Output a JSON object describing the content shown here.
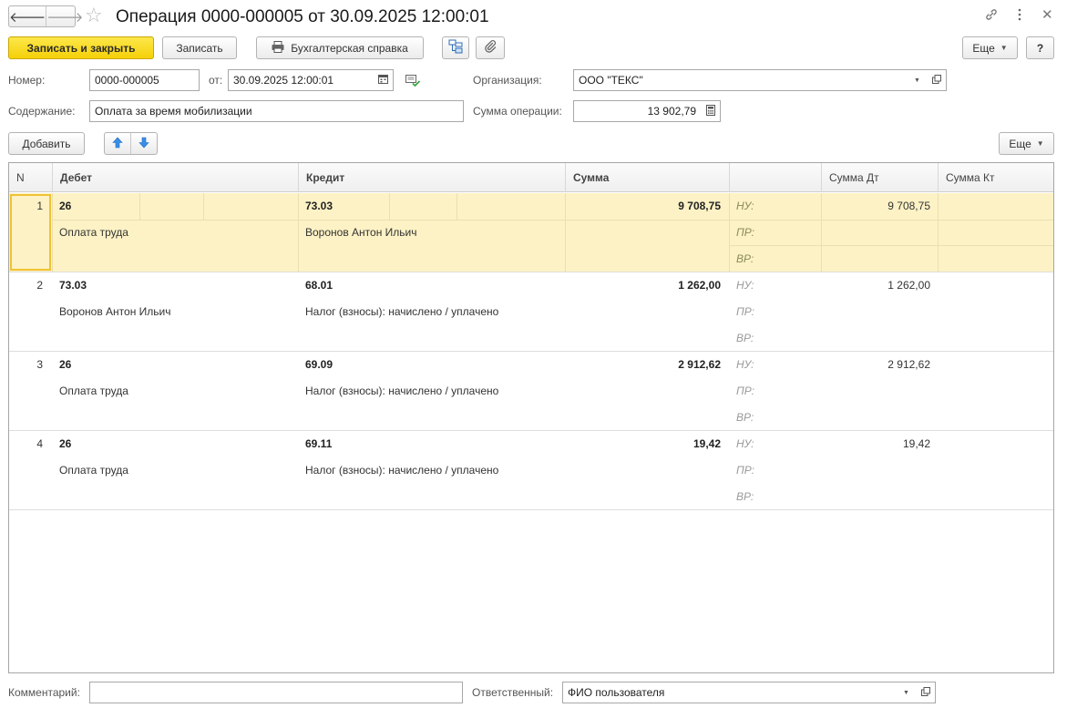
{
  "window": {
    "title": "Операция 0000-000005 от 30.09.2025 12:00:01"
  },
  "toolbar": {
    "save_close": "Записать и закрыть",
    "save": "Записать",
    "report": "Бухгалтерская справка",
    "more": "Еще",
    "help": "?"
  },
  "form": {
    "number_label": "Номер:",
    "number_value": "0000-000005",
    "date_label": "от:",
    "date_value": "30.09.2025 12:00:01",
    "org_label": "Организация:",
    "org_value": "ООО \"ТЕКС\"",
    "content_label": "Содержание:",
    "content_value": "Оплата за время мобилизации",
    "sum_label": "Сумма операции:",
    "sum_value": "13 902,79"
  },
  "table_toolbar": {
    "add": "Добавить",
    "more": "Еще"
  },
  "table": {
    "headers": {
      "n": "N",
      "debit": "Дебет",
      "credit": "Кредит",
      "sum": "Сумма",
      "sum_dt": "Сумма Дт",
      "sum_kt": "Сумма Кт"
    },
    "rows": [
      {
        "n": "1",
        "debit": "26",
        "debit_sub": "Оплата труда",
        "credit": "73.03",
        "credit_sub": "Воронов Антон Ильич",
        "sum": "9 708,75",
        "nu": "НУ:",
        "pr": "ПР:",
        "vr": "ВР:",
        "sum_dt": "9 708,75"
      },
      {
        "n": "2",
        "debit": "73.03",
        "debit_sub": "Воронов Антон Ильич",
        "credit": "68.01",
        "credit_sub": "Налог (взносы): начислено / уплачено",
        "sum": "1 262,00",
        "nu": "НУ:",
        "pr": "ПР:",
        "vr": "ВР:",
        "sum_dt": "1 262,00"
      },
      {
        "n": "3",
        "debit": "26",
        "debit_sub": "Оплата труда",
        "credit": "69.09",
        "credit_sub": "Налог (взносы): начислено / уплачено",
        "sum": "2 912,62",
        "nu": "НУ:",
        "pr": "ПР:",
        "vr": "ВР:",
        "sum_dt": "2 912,62"
      },
      {
        "n": "4",
        "debit": "26",
        "debit_sub": "Оплата труда",
        "credit": "69.11",
        "credit_sub": "Налог (взносы): начислено / уплачено",
        "sum": "19,42",
        "nu": "НУ:",
        "pr": "ПР:",
        "vr": "ВР:",
        "sum_dt": "19,42"
      }
    ]
  },
  "footer": {
    "comment_label": "Комментарий:",
    "comment_value": "",
    "responsible_label": "Ответственный:",
    "responsible_value": "ФИО пользователя"
  },
  "icons": {
    "back": "arrow-left-icon",
    "forward": "arrow-right-icon",
    "favorite": "star-icon",
    "link": "link-icon",
    "menu": "kebab-menu-icon",
    "close": "close-icon",
    "print": "printer-icon",
    "structure": "structure-icon",
    "attach": "paperclip-icon",
    "calendar": "calendar-icon",
    "calculator": "calculator-icon",
    "open": "open-window-icon",
    "up": "arrow-up-icon",
    "down": "arrow-down-icon"
  },
  "colors": {
    "primary_button": "#f5d009",
    "selected_row": "#fdf2c5",
    "selection_border": "#f0c233",
    "arrow_blue": "#3a8ee6"
  }
}
